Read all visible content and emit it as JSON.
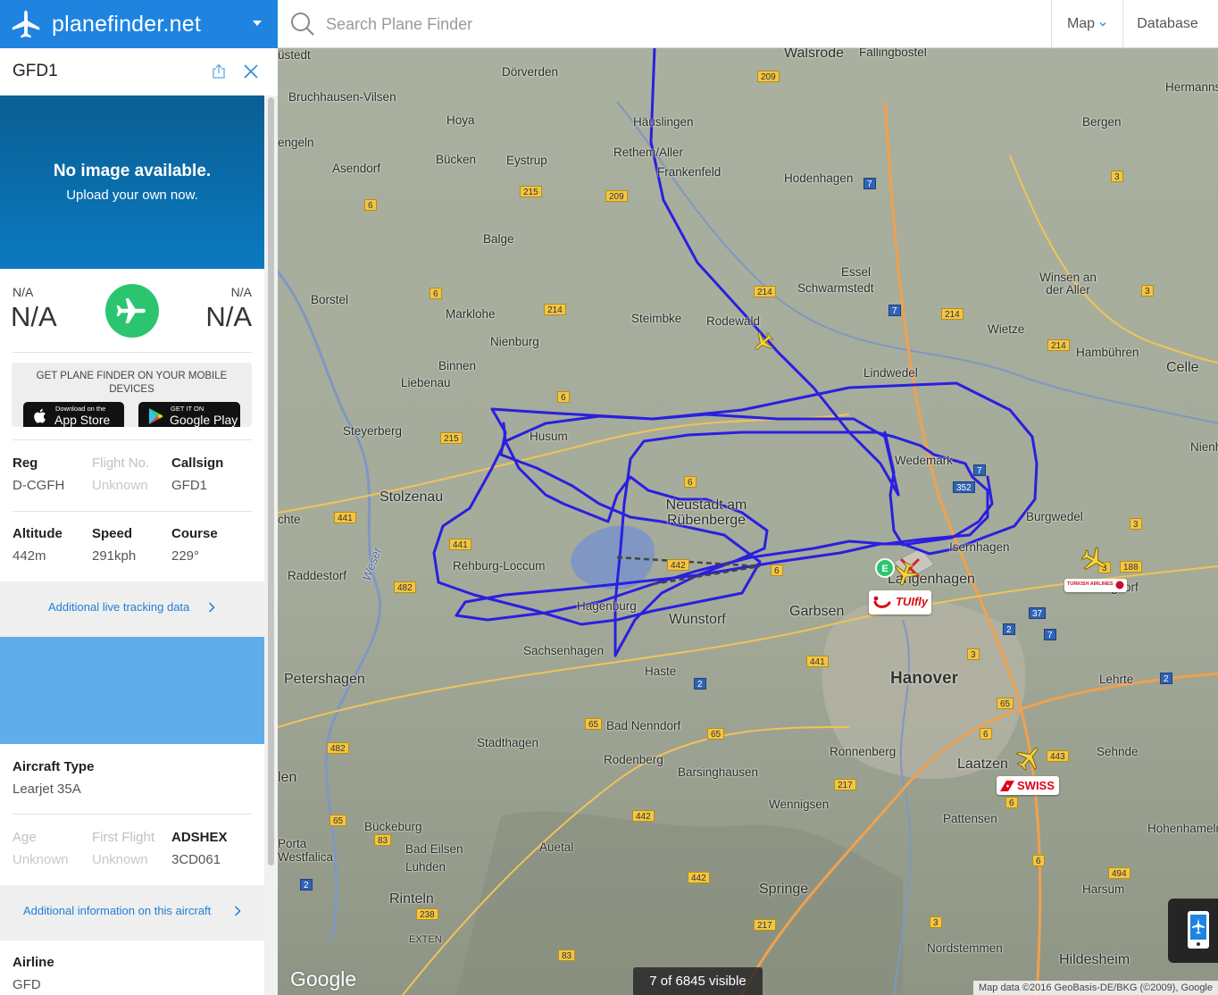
{
  "brand": {
    "name": "planefinder.net"
  },
  "search": {
    "placeholder": "Search Plane Finder"
  },
  "nav": {
    "map_label": "Map",
    "database_label": "Database"
  },
  "flight": {
    "id": "GFD1",
    "no_image_title": "No image available.",
    "no_image_sub": "Upload your own now.",
    "origin_code": "N/A",
    "origin_name": "N/A",
    "dest_code": "N/A",
    "dest_name": "N/A"
  },
  "promo": {
    "text": "GET PLANE FINDER ON YOUR MOBILE DEVICES",
    "appstore_small": "Download on the",
    "appstore_big": "App Store",
    "googleplay_small": "GET IT ON",
    "googleplay_big": "Google Play"
  },
  "details": {
    "reg_label": "Reg",
    "reg_value": "D-CGFH",
    "flightno_label": "Flight No.",
    "flightno_value": "Unknown",
    "callsign_label": "Callsign",
    "callsign_value": "GFD1",
    "altitude_label": "Altitude",
    "altitude_value": "442m",
    "speed_label": "Speed",
    "speed_value": "291kph",
    "course_label": "Course",
    "course_value": "229°",
    "live_link": "Additional live tracking data",
    "aircraft_type_label": "Aircraft Type",
    "aircraft_type_value": "Learjet 35A",
    "age_label": "Age",
    "age_value": "Unknown",
    "firstflight_label": "First Flight",
    "firstflight_value": "Unknown",
    "adshex_label": "ADSHEX",
    "adshex_value": "3CD061",
    "aircraft_link": "Additional information on this aircraft",
    "airline_label": "Airline",
    "airline_value": "GFD"
  },
  "map": {
    "places": [
      "üstedt",
      "Walsrode",
      "Fallingbostel",
      "Dörverden",
      "Hermanns",
      "Bruchhausen-Vilsen",
      "Hoya",
      "Häuslingen",
      "Bergen",
      "engeln",
      "Rethem/Aller",
      "Bücken",
      "Eystrup",
      "Frankenfeld",
      "Asendorf",
      "Hodenhagen",
      "Balge",
      "Essel",
      "Schwarmstedt",
      "Winsen an der Aller",
      "Borstel",
      "Marklohe",
      "Steimbke",
      "Rodewald",
      "Wietze",
      "Nienburg",
      "Hambühren",
      "Celle",
      "Binnen",
      "Liebenau",
      "Lindwedel",
      "Steyerberg",
      "Husum",
      "Wedemark",
      "Nienh",
      "Stolzenau",
      "Neustadt am Rübenberge",
      "Burgwedel",
      "chte",
      "Langenhagen",
      "Isernhagen",
      "Raddestorf",
      "Rehburg-Loccum",
      "Weser",
      "Burgdorf",
      "Hagenburg",
      "Garbsen",
      "Wunstorf",
      "Sachsenhagen",
      "Haste",
      "Petershagen",
      "Hanover",
      "Lehrte",
      "Bad Nenndorf",
      "Stadthagen",
      "Rodenberg",
      "Ronnenberg",
      "Sehnde",
      "Laatzen",
      "Barsinghausen",
      "len",
      "Wennigsen",
      "Pattensen",
      "Hohenhameln",
      "Bückeburg",
      "Porta Westfalica",
      "Bad Eilsen",
      "Luhden",
      "Auetal",
      "Rinteln",
      "Springe",
      "Harsum",
      "EXTEN",
      "Nordstemmen",
      "Hildesheim"
    ],
    "airline_labels": [
      "TUIfly",
      "TURKISH AIRLINES",
      "SWISS"
    ],
    "counter": "7 of 6845 visible",
    "attribution": "Map data ©2016 GeoBasis-DE/BKG (©2009), Google",
    "logo": "Google",
    "track_color": "#2a1fe0",
    "brand_color": "#1e84e0",
    "status_color": "#2cc56f"
  }
}
